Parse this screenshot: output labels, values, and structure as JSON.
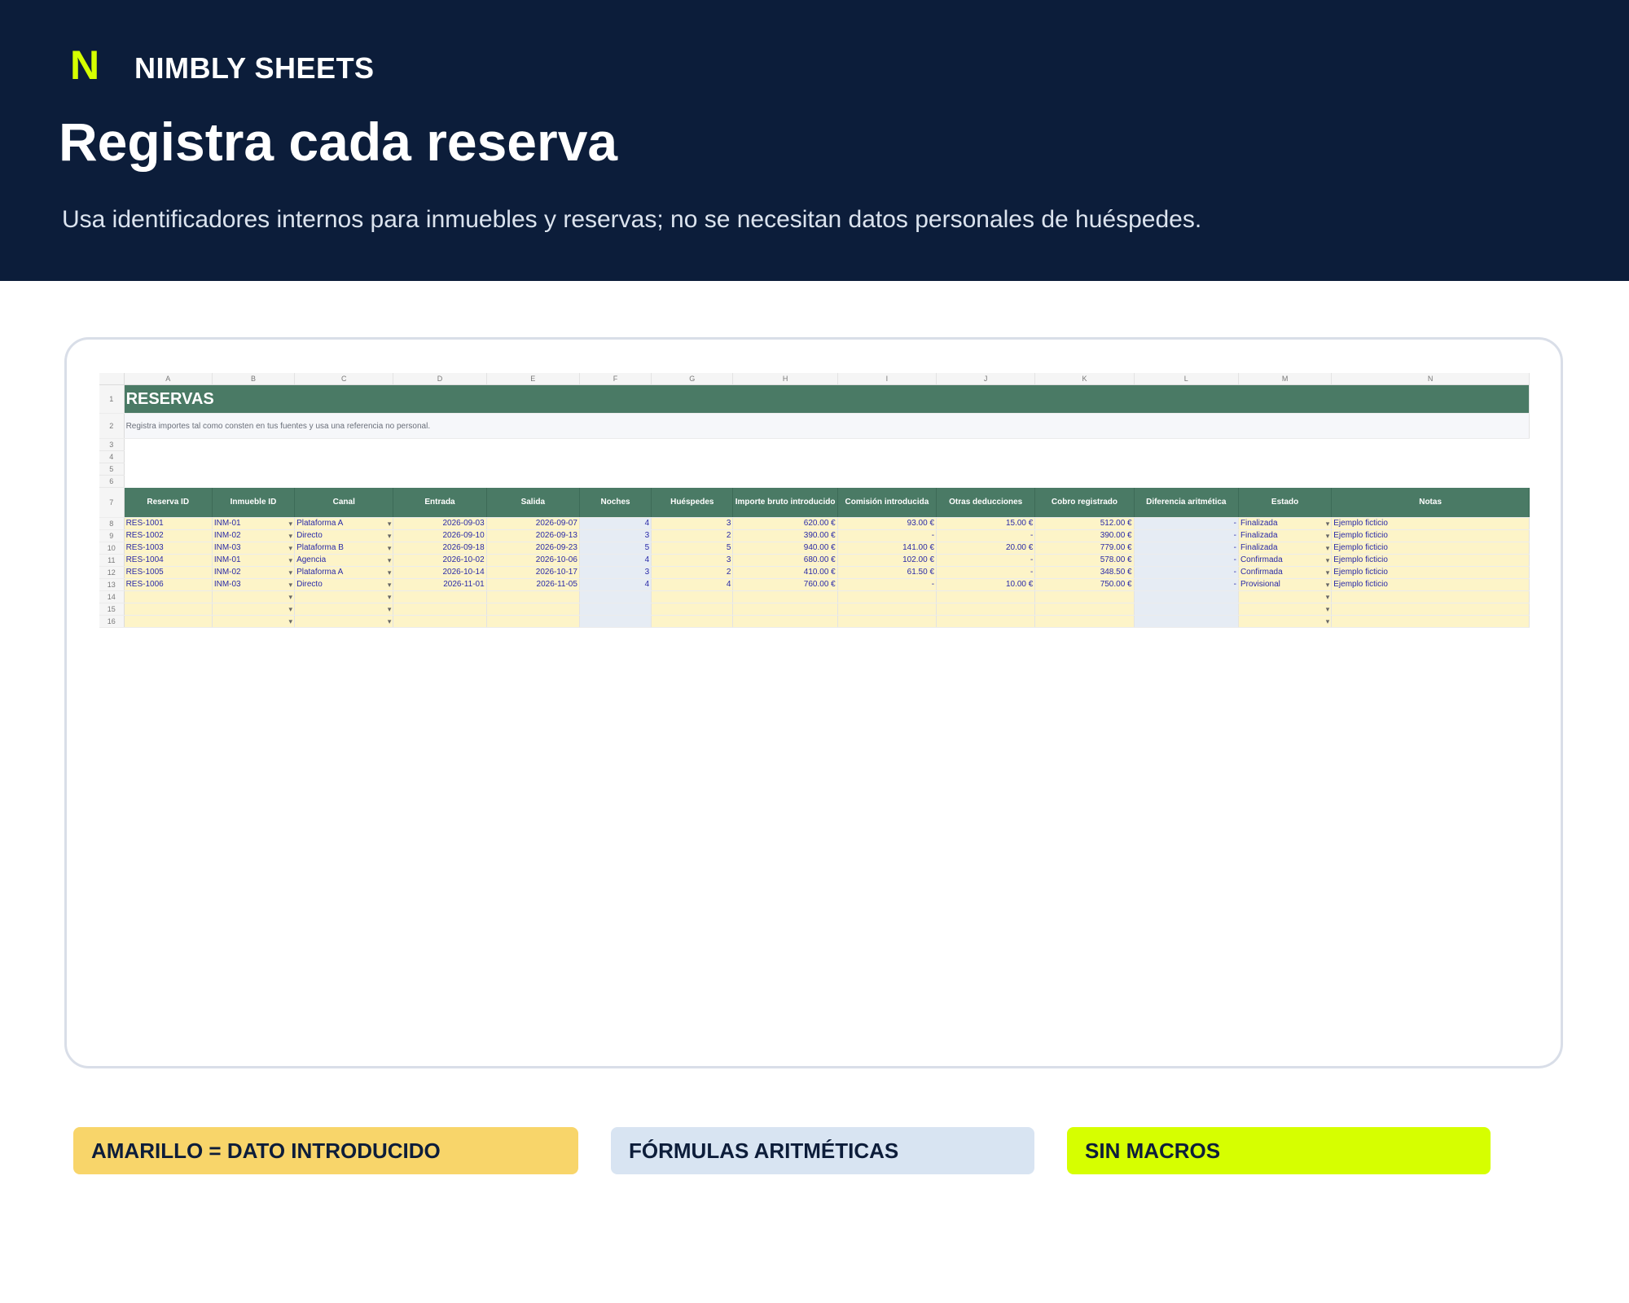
{
  "header": {
    "brand_mark": "N",
    "brand_name": "NIMBLY SHEETS",
    "title": "Registra cada reserva",
    "subtitle": "Usa identificadores internos para inmuebles y reservas; no se necesitan datos personales de huéspedes."
  },
  "sheet": {
    "columns": [
      "A",
      "B",
      "C",
      "D",
      "E",
      "F",
      "G",
      "H",
      "I",
      "J",
      "K",
      "L",
      "M",
      "N"
    ],
    "title": "RESERVAS",
    "description": "Registra importes tal como consten en tus fuentes y usa una referencia no personal.",
    "headers": [
      "Reserva ID",
      "Inmueble ID",
      "Canal",
      "Entrada",
      "Salida",
      "Noches",
      "Huéspedes",
      "Importe bruto introducido",
      "Comisión introducida",
      "Otras deducciones",
      "Cobro registrado",
      "Diferencia aritmética",
      "Estado",
      "Notas"
    ],
    "rows": [
      [
        "RES-1001",
        "INM-01",
        "Plataforma A",
        "2026-09-03",
        "2026-09-07",
        "4",
        "3",
        "620.00 €",
        "93.00 €",
        "15.00 €",
        "512.00 €",
        "-",
        "Finalizada",
        "Ejemplo ficticio"
      ],
      [
        "RES-1002",
        "INM-02",
        "Directo",
        "2026-09-10",
        "2026-09-13",
        "3",
        "2",
        "390.00 €",
        "-",
        "-",
        "390.00 €",
        "-",
        "Finalizada",
        "Ejemplo ficticio"
      ],
      [
        "RES-1003",
        "INM-03",
        "Plataforma B",
        "2026-09-18",
        "2026-09-23",
        "5",
        "5",
        "940.00 €",
        "141.00 €",
        "20.00 €",
        "779.00 €",
        "-",
        "Finalizada",
        "Ejemplo ficticio"
      ],
      [
        "RES-1004",
        "INM-01",
        "Agencia",
        "2026-10-02",
        "2026-10-06",
        "4",
        "3",
        "680.00 €",
        "102.00 €",
        "-",
        "578.00 €",
        "-",
        "Confirmada",
        "Ejemplo ficticio"
      ],
      [
        "RES-1005",
        "INM-02",
        "Plataforma A",
        "2026-10-14",
        "2026-10-17",
        "3",
        "2",
        "410.00 €",
        "61.50 €",
        "-",
        "348.50 €",
        "-",
        "Confirmada",
        "Ejemplo ficticio"
      ],
      [
        "RES-1006",
        "INM-03",
        "Directo",
        "2026-11-01",
        "2026-11-05",
        "4",
        "4",
        "760.00 €",
        "-",
        "10.00 €",
        "750.00 €",
        "-",
        "Provisional",
        "Ejemplo ficticio"
      ]
    ],
    "row_numbers": [
      "1",
      "2",
      "3",
      "4",
      "5",
      "6",
      "7",
      "8",
      "9",
      "10",
      "11",
      "12",
      "13",
      "14",
      "15",
      "16"
    ]
  },
  "legend": {
    "input": "AMARILLO = DATO INTRODUCIDO",
    "formulas": "FÓRMULAS ARITMÉTICAS",
    "macros": "SIN MACROS"
  },
  "colors": {
    "hero_bg": "#0c1d3a",
    "accent": "#d6ff00",
    "sheet_header": "#4a7a65",
    "input_cell": "#fdf4c8",
    "formula_cell": "#e6ecf4"
  }
}
